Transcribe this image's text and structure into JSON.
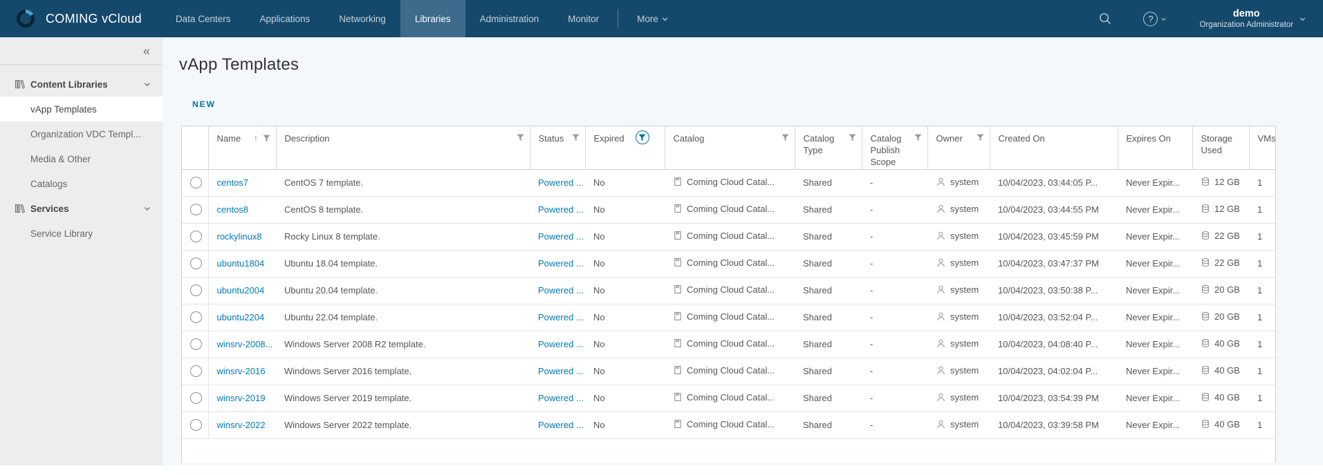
{
  "topnav": {
    "brand": "COMING vCloud",
    "items": [
      {
        "label": "Data Centers",
        "selected": false
      },
      {
        "label": "Applications",
        "selected": false
      },
      {
        "label": "Networking",
        "selected": false
      },
      {
        "label": "Libraries",
        "selected": true
      },
      {
        "label": "Administration",
        "selected": false
      },
      {
        "label": "Monitor",
        "selected": false
      }
    ],
    "more_label": "More",
    "help_glyph": "?",
    "user": {
      "name": "demo",
      "role": "Organization Administrator"
    }
  },
  "sidebar": {
    "collapse_glyph": "«",
    "groups": [
      {
        "label": "Content Libraries",
        "items": [
          {
            "label": "vApp Templates",
            "selected": true
          },
          {
            "label": "Organization VDC Templ...",
            "selected": false
          },
          {
            "label": "Media & Other",
            "selected": false
          },
          {
            "label": "Catalogs",
            "selected": false
          }
        ]
      },
      {
        "label": "Services",
        "items": [
          {
            "label": "Service Library",
            "selected": false
          }
        ]
      }
    ]
  },
  "main": {
    "title": "vApp Templates",
    "new_button": "NEW",
    "table": {
      "columns": [
        {
          "label": "Name",
          "sorted": "asc",
          "filter": true
        },
        {
          "label": "Description",
          "filter": true
        },
        {
          "label": "Status",
          "filter": true
        },
        {
          "label": "Expired",
          "filter": true,
          "filter_active": true
        },
        {
          "label": "Catalog",
          "filter": true
        },
        {
          "label": "Catalog Type",
          "filter": true
        },
        {
          "label": "Catalog Publish Scope",
          "filter": true
        },
        {
          "label": "Owner",
          "filter": true
        },
        {
          "label": "Created On",
          "filter": false
        },
        {
          "label": "Expires On",
          "filter": false
        },
        {
          "label": "Storage Used",
          "filter": false
        },
        {
          "label": "VMs",
          "filter": false
        }
      ],
      "rows": [
        {
          "name": "centos7",
          "desc": "CentOS 7 template.",
          "status": "Powered ...",
          "expired": "No",
          "catalog": "Coming Cloud Catal...",
          "type": "Shared",
          "scope": "-",
          "owner": "system",
          "created": "10/04/2023, 03:44:05 P...",
          "expires": "Never Expir...",
          "storage": "12 GB",
          "vms": "1"
        },
        {
          "name": "centos8",
          "desc": "CentOS 8 template.",
          "status": "Powered ...",
          "expired": "No",
          "catalog": "Coming Cloud Catal...",
          "type": "Shared",
          "scope": "-",
          "owner": "system",
          "created": "10/04/2023, 03:44:55 PM",
          "expires": "Never Expir...",
          "storage": "12 GB",
          "vms": "1"
        },
        {
          "name": "rockylinux8",
          "desc": "Rocky Linux 8 template.",
          "status": "Powered ...",
          "expired": "No",
          "catalog": "Coming Cloud Catal...",
          "type": "Shared",
          "scope": "-",
          "owner": "system",
          "created": "10/04/2023, 03:45:59 PM",
          "expires": "Never Expir...",
          "storage": "22 GB",
          "vms": "1"
        },
        {
          "name": "ubuntu1804",
          "desc": "Ubuntu 18.04 template.",
          "status": "Powered ...",
          "expired": "No",
          "catalog": "Coming Cloud Catal...",
          "type": "Shared",
          "scope": "-",
          "owner": "system",
          "created": "10/04/2023, 03:47:37 PM",
          "expires": "Never Expir...",
          "storage": "22 GB",
          "vms": "1"
        },
        {
          "name": "ubuntu2004",
          "desc": "Ubuntu 20.04 template.",
          "status": "Powered ...",
          "expired": "No",
          "catalog": "Coming Cloud Catal...",
          "type": "Shared",
          "scope": "-",
          "owner": "system",
          "created": "10/04/2023, 03:50:38 P...",
          "expires": "Never Expir...",
          "storage": "20 GB",
          "vms": "1"
        },
        {
          "name": "ubuntu2204",
          "desc": "Ubuntu 22.04 template.",
          "status": "Powered ...",
          "expired": "No",
          "catalog": "Coming Cloud Catal...",
          "type": "Shared",
          "scope": "-",
          "owner": "system",
          "created": "10/04/2023, 03:52:04 P...",
          "expires": "Never Expir...",
          "storage": "20 GB",
          "vms": "1"
        },
        {
          "name": "winsrv-2008...",
          "desc": "Windows Server 2008 R2 template.",
          "status": "Powered ...",
          "expired": "No",
          "catalog": "Coming Cloud Catal...",
          "type": "Shared",
          "scope": "-",
          "owner": "system",
          "created": "10/04/2023, 04:08:40 P...",
          "expires": "Never Expir...",
          "storage": "40 GB",
          "vms": "1"
        },
        {
          "name": "winsrv-2016",
          "desc": "Windows Server 2016 template.",
          "status": "Powered ...",
          "expired": "No",
          "catalog": "Coming Cloud Catal...",
          "type": "Shared",
          "scope": "-",
          "owner": "system",
          "created": "10/04/2023, 04:02:04 P...",
          "expires": "Never Expir...",
          "storage": "40 GB",
          "vms": "1"
        },
        {
          "name": "winsrv-2019",
          "desc": "Windows Server 2019 template.",
          "status": "Powered ...",
          "expired": "No",
          "catalog": "Coming Cloud Catal...",
          "type": "Shared",
          "scope": "-",
          "owner": "system",
          "created": "10/04/2023, 03:54:39 PM",
          "expires": "Never Expir...",
          "storage": "40 GB",
          "vms": "1"
        },
        {
          "name": "winsrv-2022",
          "desc": "Windows Server 2022 template.",
          "status": "Powered ...",
          "expired": "No",
          "catalog": "Coming Cloud Catal...",
          "type": "Shared",
          "scope": "-",
          "owner": "system",
          "created": "10/04/2023, 03:39:58 PM",
          "expires": "Never Expir...",
          "storage": "40 GB",
          "vms": "1"
        }
      ]
    }
  },
  "colors": {
    "nav_bg": "#15496c",
    "nav_selected": "#3e6a8c",
    "link": "#0079b8",
    "accent": "#0072a3",
    "sidebar_bg": "#ededed",
    "main_bg": "#f4f8fb"
  }
}
